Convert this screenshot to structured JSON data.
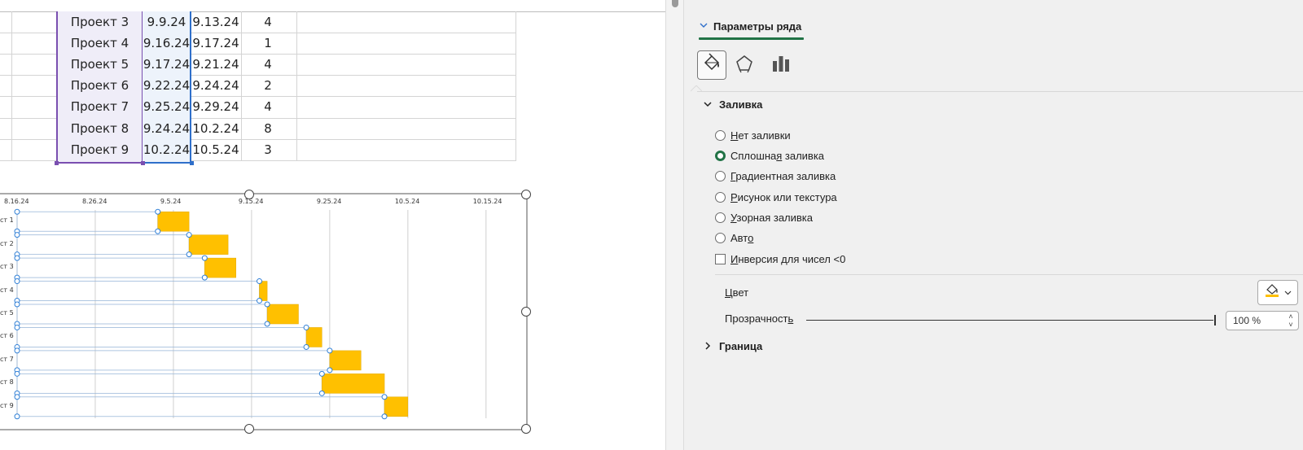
{
  "sheet": {
    "rows": [
      {
        "name": "Проект 3",
        "start": "9.9.24",
        "end": "9.13.24",
        "duration": "4"
      },
      {
        "name": "Проект 4",
        "start": "9.16.24",
        "end": "9.17.24",
        "duration": "1"
      },
      {
        "name": "Проект 5",
        "start": "9.17.24",
        "end": "9.21.24",
        "duration": "4"
      },
      {
        "name": "Проект 6",
        "start": "9.22.24",
        "end": "9.24.24",
        "duration": "2"
      },
      {
        "name": "Проект 7",
        "start": "9.25.24",
        "end": "9.29.24",
        "duration": "4"
      },
      {
        "name": "Проект 8",
        "start": "9.24.24",
        "end": "10.2.24",
        "duration": "8"
      },
      {
        "name": "Проект 9",
        "start": "10.2.24",
        "end": "10.5.24",
        "duration": "3"
      }
    ]
  },
  "chart_data": {
    "type": "bar",
    "orientation": "horizontal-stacked",
    "title": "",
    "x_ticks": [
      "8.16.24",
      "8.26.24",
      "9.5.24",
      "9.15.24",
      "9.25.24",
      "10.5.24",
      "10.15.24"
    ],
    "categories": [
      "ст 1",
      "ст 2",
      "ст 3",
      "ст 4",
      "ст 5",
      "ст 6",
      "ст 7",
      "ст 8",
      "ст 9"
    ],
    "series": [
      {
        "name": "",
        "role": "offset-days-from-8.16.24",
        "values": [
          18,
          22,
          24,
          31,
          32,
          37,
          40,
          39,
          47
        ],
        "color": "#ffffff"
      },
      {
        "name": "",
        "role": "duration-days",
        "values": [
          4,
          5,
          4,
          1,
          4,
          2,
          4,
          8,
          3
        ],
        "color": "#ffc000"
      }
    ],
    "xlim_days": [
      0,
      62
    ],
    "grid": true,
    "selected_series": 0
  },
  "pane": {
    "series_options_title": "Параметры ряда",
    "tabs": [
      {
        "icon": "paint-bucket-icon",
        "label": "Заливка и границы"
      },
      {
        "icon": "pentagon-icon",
        "label": "Эффекты"
      },
      {
        "icon": "bar-chart-icon",
        "label": "Параметры ряда"
      }
    ],
    "fill_section": {
      "title": "Заливка",
      "options": [
        {
          "label_pre": "",
          "label_u": "Н",
          "label_post": "ет заливки",
          "checked": false
        },
        {
          "label_pre": "Сплошна",
          "label_u": "я",
          "label_post": " заливка",
          "checked": true
        },
        {
          "label_pre": "",
          "label_u": "Г",
          "label_post": "радиентная заливка",
          "checked": false
        },
        {
          "label_pre": "",
          "label_u": "Р",
          "label_post": "исунок или текстура",
          "checked": false
        },
        {
          "label_pre": "",
          "label_u": "У",
          "label_post": "зорная заливка",
          "checked": false
        },
        {
          "label_pre": "Авт",
          "label_u": "о",
          "label_post": "",
          "checked": false
        }
      ],
      "invert_pre": "",
      "invert_u": "И",
      "invert_post": "нверсия для чисел <0",
      "color_label_u": "Ц",
      "color_label_post": "вет",
      "transparency_label_pre": "Прозрачност",
      "transparency_label_u": "ь",
      "transparency_value": "100 %",
      "transparency_percent": 100,
      "accent_color": "#ffc000"
    },
    "border_section": {
      "title": "Граница"
    }
  }
}
